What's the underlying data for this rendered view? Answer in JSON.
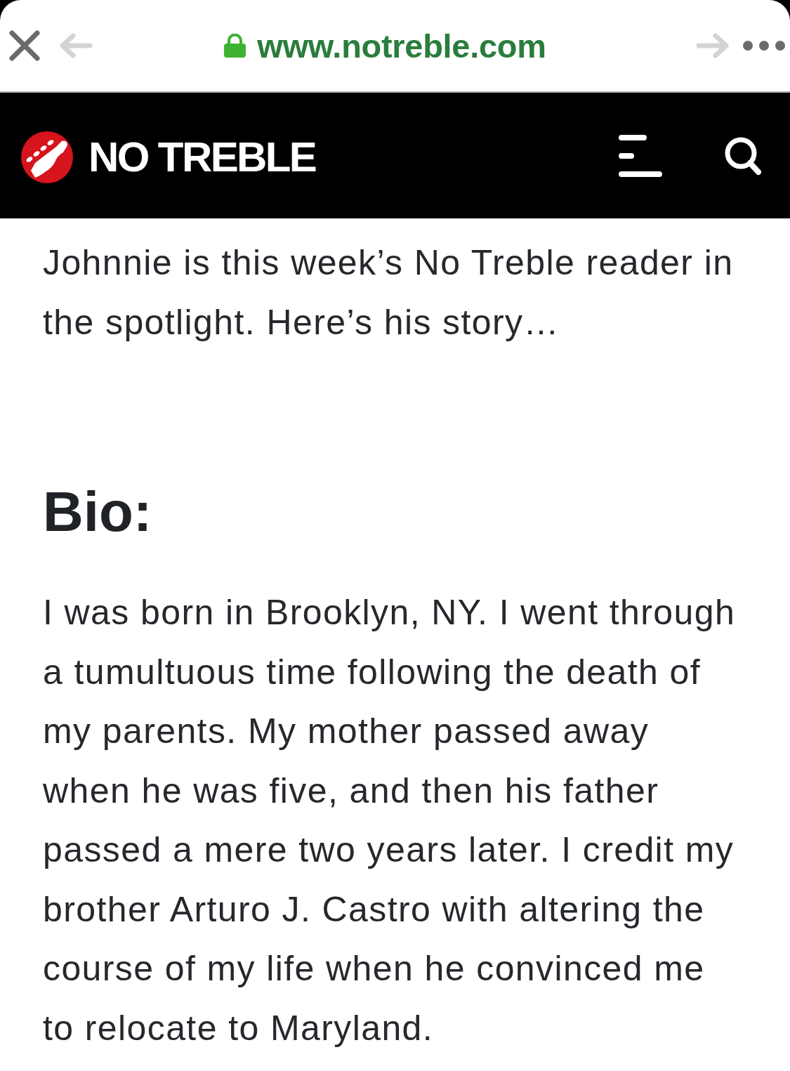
{
  "browser": {
    "url": "www.notreble.com",
    "secure": true,
    "back": {
      "disabled": true
    },
    "forward": {
      "disabled": true
    }
  },
  "site_header": {
    "logo_text": "NO TREBLE"
  },
  "article": {
    "intro": "Johnnie is this week’s No Treble reader in the spotlight. Here’s his story…",
    "heading": "Bio:",
    "paragraphs": [
      "I was born in Brooklyn, NY. I went through a tumultuous time following the death of my parents. My mother passed away when he was five, and then his father passed a mere two years later. I credit my brother Arturo J. Castro with altering the course of my life when he convinced me to relocate to Maryland."
    ]
  }
}
